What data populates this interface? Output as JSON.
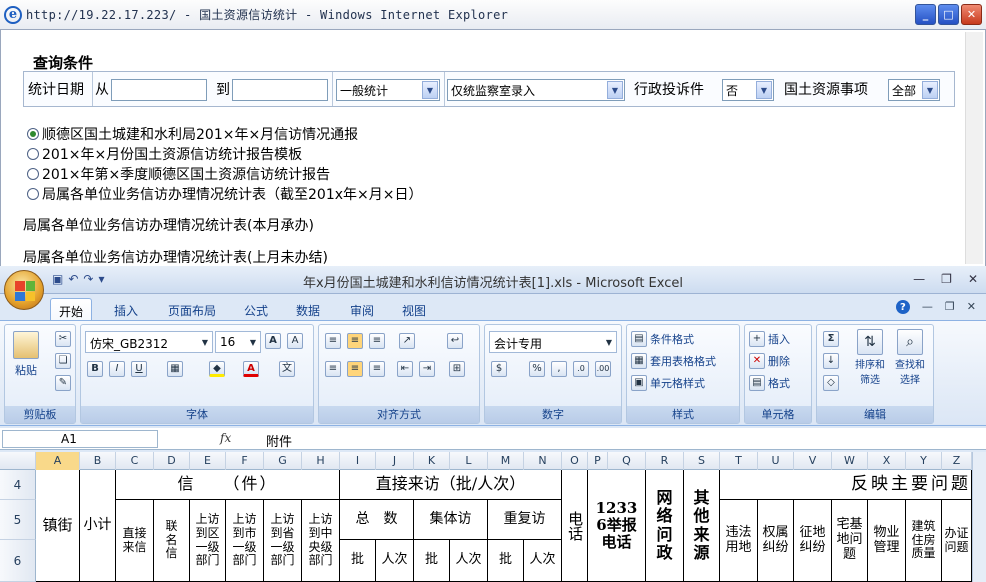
{
  "ie": {
    "title": "http://19.22.17.223/ - 国土资源信访统计 - Windows Internet Explorer",
    "win_min": "_",
    "win_max": "□",
    "win_close": "✕",
    "query": {
      "title": "查询条件",
      "date_label": "统计日期",
      "from_label": "从",
      "to_label": "到",
      "from_value": "",
      "to_value": "",
      "stat_type": "一般统计",
      "entry_source": "仅统监察室录入",
      "admin_label": "行政投诉件",
      "admin_value": "否",
      "matter_label": "国土资源事项",
      "matter_value": "全部"
    },
    "reports": [
      {
        "label": "顺德区国土城建和水利局201×年×月信访情况通报",
        "selected": true
      },
      {
        "label": "201×年×月份国土资源信访统计报告模板",
        "selected": false
      },
      {
        "label": "201×年第×季度顺德区国土资源信访统计报告",
        "selected": false
      },
      {
        "label": "局属各单位业务信访办理情况统计表（截至201x年×月×日）",
        "selected": false
      }
    ],
    "extra_reports": [
      "局属各单位业务信访办理情况统计表(本月承办)",
      "局属各单位业务信访办理情况统计表(上月未办结)"
    ]
  },
  "excel": {
    "title": "年x月份国土城建和水利信访情况统计表[1].xls - Microsoft Excel",
    "tabs": [
      "开始",
      "插入",
      "页面布局",
      "公式",
      "数据",
      "审阅",
      "视图"
    ],
    "active_tab": "开始",
    "ribbon": {
      "clipboard": {
        "label": "剪贴板",
        "paste": "粘贴"
      },
      "font": {
        "label": "字体",
        "name": "仿宋_GB2312",
        "size": "16",
        "bold": "B",
        "italic": "I",
        "underline": "U"
      },
      "align": {
        "label": "对齐方式"
      },
      "number": {
        "label": "数字",
        "format": "会计专用"
      },
      "style": {
        "label": "样式",
        "cond": "条件格式",
        "table": "套用表格格式",
        "cell": "单元格样式"
      },
      "cells": {
        "label": "单元格",
        "insert": "插入",
        "delete": "删除",
        "format": "格式"
      },
      "edit": {
        "label": "编辑",
        "sort": "排序和筛选",
        "find": "查找和选择"
      }
    },
    "name_box": "A1",
    "fx": "fx",
    "formula": "附件",
    "columns": [
      "A",
      "B",
      "C",
      "D",
      "E",
      "F",
      "G",
      "H",
      "I",
      "J",
      "K",
      "L",
      "M",
      "N",
      "O",
      "P",
      "Q",
      "R",
      "S",
      "T",
      "U",
      "V",
      "W",
      "X",
      "Y",
      "Z"
    ],
    "rows": [
      "4",
      "5",
      "6"
    ],
    "cells": {
      "zhenjie": "镇街",
      "xiaoji": "小计",
      "xin": "信　　（件）",
      "direct": "直接来访（批/人次）",
      "phone": "电话",
      "p12336": "12336举报电话",
      "web": "网络问政",
      "other": "其他来源",
      "reflect": "反映主要问题",
      "c_direct": "直接来信",
      "c_joint": "联名信",
      "c_district": "上访到区一级部门",
      "c_city": "上访到市一级部门",
      "c_province": "上访到省一级部门",
      "c_central": "上访到中央级部门",
      "total": "总　数",
      "group": "集体访",
      "repeat": "重复访",
      "pi": "批",
      "renci": "人次",
      "illegal_land": "违法用地",
      "ownership": "权属纠纷",
      "acquisition": "征地纠纷",
      "homestead": "宅基地问题",
      "property": "物业管理",
      "building": "建筑住房质量",
      "office": "办证问题"
    }
  }
}
